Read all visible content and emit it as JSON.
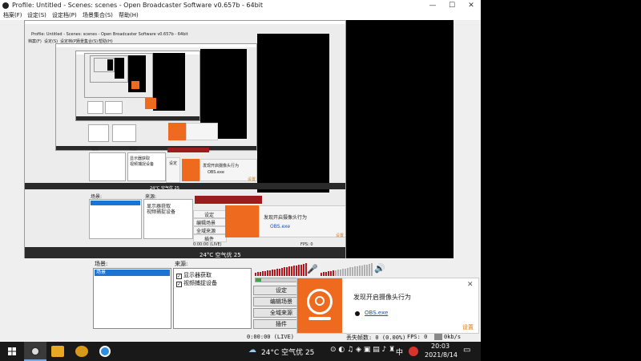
{
  "window": {
    "title": "Profile: Untitled - Scenes: scenes - Open Broadcaster Software v0.657b - 64bit",
    "minimize": "—",
    "maximize": "☐",
    "close": "✕"
  },
  "menu": [
    "档案(F)",
    "设定(S)",
    "设定档(P)",
    "场景集合(S)",
    "帮助(H)"
  ],
  "nested": {
    "title": "Profile: Untitled - Scenes: scenes - Open Broadcaster Software v0.657b - 64bit",
    "menu": [
      "档案(F)",
      "设定(S)",
      "设定档(P)",
      "场景集合(S)",
      "帮助(H)"
    ],
    "scenes_label": "场景:",
    "sources_label": "来源:",
    "scene_item": "场景",
    "sources": [
      "显示器获取",
      "视频捕捉设备"
    ],
    "buttons": [
      "设定",
      "编辑场景",
      "全域来源",
      "插件"
    ],
    "status_time": "0:00:00 (LIVE)",
    "notif_title": "发现开启摄像头行为",
    "notif_app": "OBS.exe",
    "notif_settings": "设置",
    "weather": "24°C 空气优 25",
    "fps": "FPS: 0"
  },
  "panel": {
    "scenes_label": "场景:",
    "sources_label": "来源:",
    "scene_item": "场景",
    "sources": [
      "显示器获取",
      "视频捕捉设备"
    ],
    "buttons": [
      "设定",
      "编辑场景",
      "全域来源",
      "插件"
    ],
    "status_time": "0:00:00 (LIVE)",
    "dropped": "丢失帧数: 0 (0.00%)",
    "fps": "FPS: 0",
    "bitrate": "0kb/s",
    "check": "✓"
  },
  "notification": {
    "title": "发现开启摄像头行为",
    "app": "OBS.exe",
    "settings": "设置",
    "close": "✕"
  },
  "taskbar": {
    "weather": "24°C 空气优 25",
    "ime": "中",
    "time": "20:03",
    "date": "2021/8/14"
  },
  "colors": {
    "accent_orange": "#ee6a1f",
    "selection_blue": "#1b74d4",
    "vu_red": "#b3161c",
    "vu_green": "#3fa33f"
  }
}
